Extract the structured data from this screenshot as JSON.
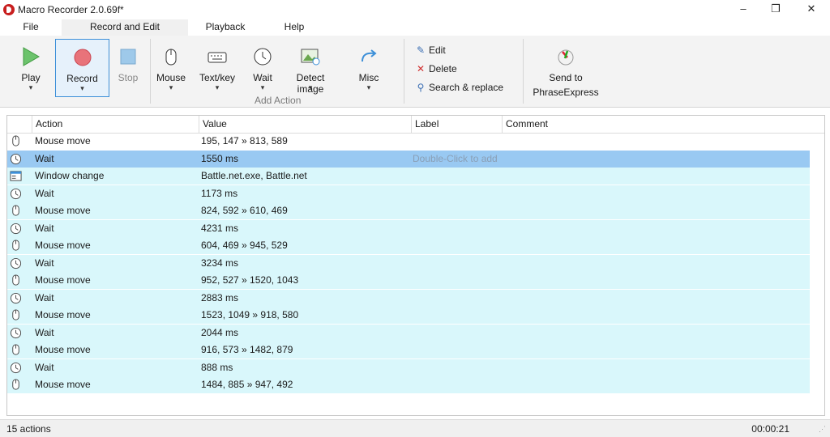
{
  "window": {
    "title": "Macro Recorder 2.0.69f*",
    "minimize": "–",
    "maximize": "❐",
    "close": "✕"
  },
  "menu": [
    "File",
    "Record and Edit",
    "Playback",
    "Help"
  ],
  "ribbon": {
    "play": "Play",
    "record": "Record",
    "stop": "Stop",
    "mouse": "Mouse",
    "textkey": "Text/key",
    "wait": "Wait",
    "detect": "Detect image",
    "misc": "Misc",
    "add_action_label": "Add Action",
    "edit": "Edit",
    "delete": "Delete",
    "search_replace": "Search & replace",
    "send_to_1": "Send to",
    "send_to_2": "PhraseExpress",
    "caret": "▾"
  },
  "grid": {
    "columns": [
      "Action",
      "Value",
      "Label",
      "Comment"
    ],
    "label_placeholder": "Double-Click to add la",
    "rows": [
      {
        "icon": "mouse-icon",
        "action": "Mouse move",
        "value": "195, 147 » 813, 589"
      },
      {
        "icon": "clock-icon",
        "action": "Wait",
        "value": "1550 ms"
      },
      {
        "icon": "window-icon",
        "action": "Window change",
        "value": "Battle.net.exe, Battle.net"
      },
      {
        "icon": "clock-icon",
        "action": "Wait",
        "value": "1173 ms"
      },
      {
        "icon": "mouse-icon",
        "action": "Mouse move",
        "value": "824, 592 » 610, 469"
      },
      {
        "icon": "clock-icon",
        "action": "Wait",
        "value": "4231 ms"
      },
      {
        "icon": "mouse-icon",
        "action": "Mouse move",
        "value": "604, 469 » 945, 529"
      },
      {
        "icon": "clock-icon",
        "action": "Wait",
        "value": "3234 ms"
      },
      {
        "icon": "mouse-icon",
        "action": "Mouse move",
        "value": "952, 527 » 1520, 1043"
      },
      {
        "icon": "clock-icon",
        "action": "Wait",
        "value": "2883 ms"
      },
      {
        "icon": "mouse-icon",
        "action": "Mouse move",
        "value": "1523, 1049 » 918, 580"
      },
      {
        "icon": "clock-icon",
        "action": "Wait",
        "value": "2044 ms"
      },
      {
        "icon": "mouse-icon",
        "action": "Mouse move",
        "value": "916, 573 » 1482, 879"
      },
      {
        "icon": "clock-icon",
        "action": "Wait",
        "value": "888 ms"
      },
      {
        "icon": "mouse-icon",
        "action": "Mouse move",
        "value": "1484, 885 » 947, 492"
      }
    ],
    "selected_row": 1
  },
  "status": {
    "count": "15 actions",
    "time": "00:00:21"
  },
  "colors": {
    "selected_row": "#99c9f2",
    "row_fill": "#d9f7fb",
    "record_red": "#e8545b",
    "play_green": "#4cb84c",
    "accent_blue": "#3c8fd8"
  }
}
